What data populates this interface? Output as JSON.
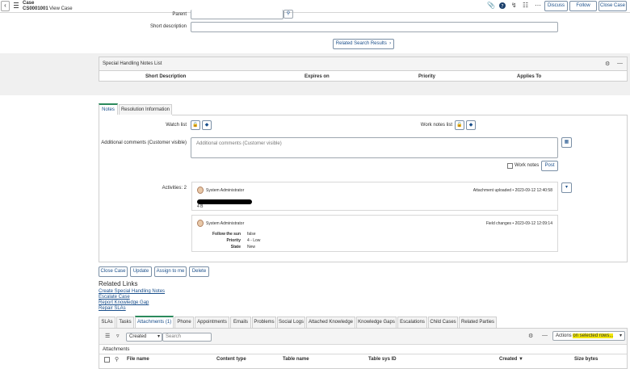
{
  "header": {
    "record_type": "Case",
    "record_number": "CS0001001",
    "view_label": "View Case",
    "discuss_label": "Discuss",
    "follow_label": "Follow",
    "close_case_label": "Close Case"
  },
  "form": {
    "parent_label": "Parent",
    "short_description_label": "Short description",
    "related_search_label": "Related Search Results"
  },
  "special_handling": {
    "title": "Special Handling Notes List",
    "columns": [
      "Short Description",
      "Expires on",
      "Priority",
      "Applies To"
    ]
  },
  "notes": {
    "tabs": [
      "Notes",
      "Resolution Information"
    ],
    "watch_list_label": "Watch list",
    "work_notes_list_label": "Work notes list",
    "additional_comments_label": "Additional comments (Customer visible)",
    "additional_comments_placeholder": "Additional comments (Customer visible)",
    "work_notes_label": "Work notes",
    "post_label": "Post",
    "activities_label": "Activities: 2"
  },
  "activities": [
    {
      "user": "System Administrator",
      "type": "Attachment uploaded",
      "timestamp": "2023-09-12 12:40:58",
      "detail": "4 B"
    },
    {
      "user": "System Administrator",
      "type": "Field changes",
      "timestamp": "2023-09-12 12:09:14",
      "changes": [
        {
          "field": "Follow the sun",
          "value": "false"
        },
        {
          "field": "Priority",
          "value": "4 - Low"
        },
        {
          "field": "State",
          "value": "New"
        }
      ]
    }
  ],
  "action_buttons": {
    "close_case": "Close Case",
    "update": "Update",
    "assign_to_me": "Assign to me",
    "delete": "Delete"
  },
  "related_links": {
    "title": "Related Links",
    "links": [
      "Create Special Handling Notes",
      "Escalate Case",
      "Report Knowledge Gap",
      "Repair SLAs"
    ]
  },
  "related_lists": {
    "tabs": [
      "SLAs",
      "Tasks",
      "Attachments (1)",
      "Phone",
      "Appointments",
      "Emails",
      "Problems",
      "Social Logs",
      "Attached Knowledge",
      "Knowledge Gaps",
      "Escalations",
      "Child Cases",
      "Related Parties"
    ],
    "filter_field": "Created",
    "search_placeholder": "Search",
    "actions_prefix": "Actions ",
    "actions_highlight": "on selected rows...",
    "list_title": "Attachments",
    "columns": [
      "File name",
      "Content type",
      "Table name",
      "Table sys ID",
      "Created ▼",
      "Size bytes"
    ]
  },
  "colors": {
    "accent": "#1a4f8b",
    "active_tab": "#2b8a5c",
    "highlight": "#f3e80c"
  }
}
